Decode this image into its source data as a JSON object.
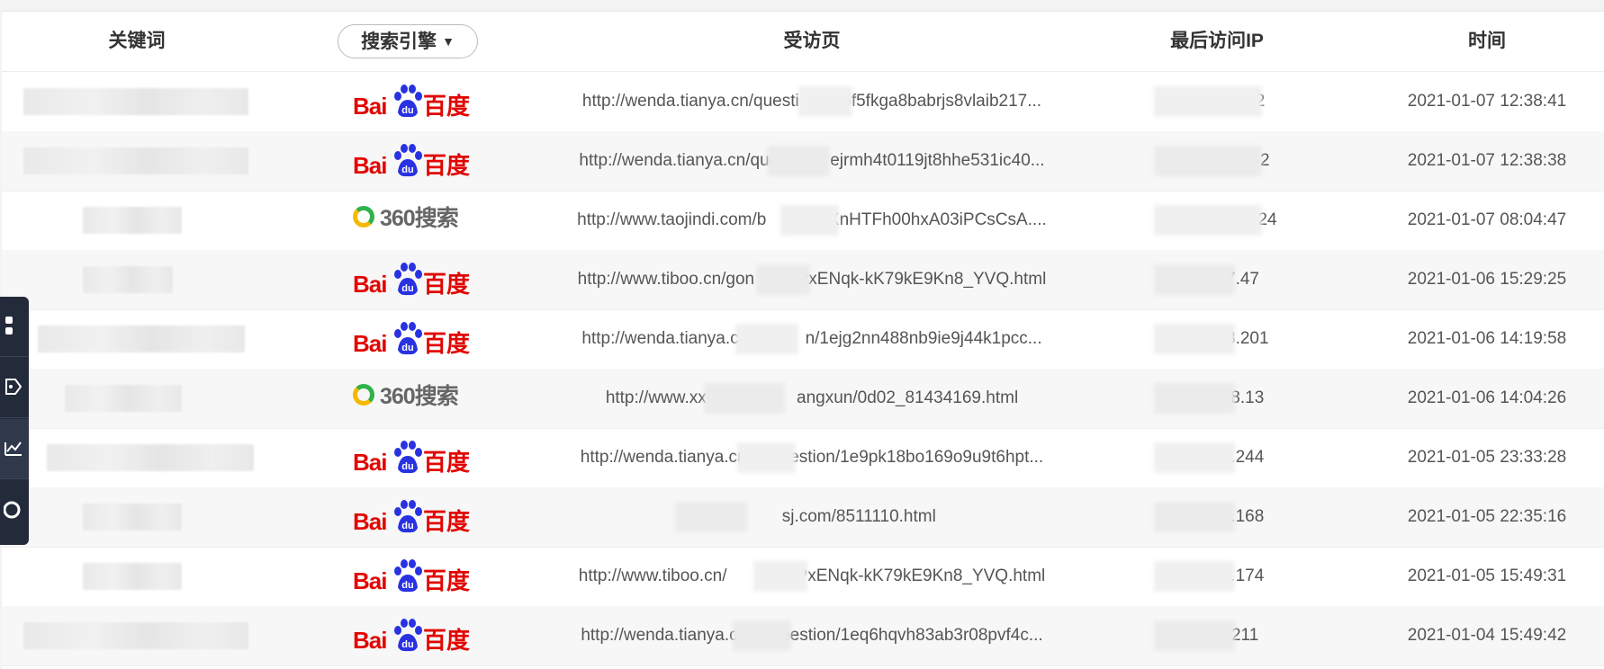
{
  "table": {
    "headers": {
      "keyword": "关键词",
      "search_engine": "搜索引擎",
      "visited_page": "受访页",
      "last_ip": "最后访问IP",
      "time": "时间"
    },
    "search_engine_caret": "▼",
    "rows": [
      {
        "keyword": "",
        "engine": "baidu",
        "url": "http://wenda.tianya.cn/questi█████5f5fkga8babrjs8vlaib217...",
        "ip": "1█████████2",
        "time": "2021-01-07 12:38:41"
      },
      {
        "keyword": "",
        "engine": "baidu",
        "url": "http://wenda.tianya.cn/ques█████ejrmh4t0119jt8hhe531ic40...",
        "ip": "1█████████42",
        "time": "2021-01-07 12:38:38"
      },
      {
        "keyword": "",
        "engine": "360",
        "url": "http://www.taojindi.com/b█████/-xXnHTFh00hxA03iPCsCsA....",
        "ip": "1█████████.124",
        "time": "2021-01-07 08:04:47"
      },
      {
        "keyword": "",
        "engine": "baidu",
        "url": "http://www.tiboo.cn/gon█████PxENqk-kK79kE9Kn8_YVQ.html",
        "ip": "██████7.47",
        "time": "2021-01-06 15:29:25"
      },
      {
        "keyword": "",
        "engine": "baidu",
        "url": "http://wenda.tianya.cn/q█████n/1ejg2nn488nb9ie9j44k1pcc...",
        "ip": "██████38.201",
        "time": "2021-01-06 14:19:58"
      },
      {
        "keyword": "",
        "engine": "360",
        "url": "http://www.xxcmw.c█████angxun/0d02_81434169.html",
        "ip": "██████78.13",
        "time": "2021-01-06 14:04:26"
      },
      {
        "keyword": "",
        "engine": "baidu",
        "url": "http://wenda.tianya.cn█████estion/1e9pk18bo169o9u9t6hpt...",
        "ip": "██████4.244",
        "time": "2021-01-05 23:33:28"
      },
      {
        "keyword": "",
        "engine": "baidu",
        "url": "https://█████sj.com/8511110.html",
        "ip": "██████9.168",
        "time": "2021-01-05 22:35:16"
      },
      {
        "keyword": "",
        "engine": "baidu",
        "url": "http://www.tiboo.cn/█████e/HPxENqk-kK79kE9Kn8_YVQ.html",
        "ip": "██████8.174",
        "time": "2021-01-05 15:49:31"
      },
      {
        "keyword": "",
        "engine": "baidu",
        "url": "http://wenda.tianya.c█████uestion/1eq6hqvh83ab3r08pvf4c...",
        "ip": "██████.211",
        "time": "2021-01-04 15:49:42"
      }
    ]
  },
  "logos": {
    "baidu_left": "Bai",
    "baidu_paw": "du",
    "baidu_right": "百度",
    "so360": "360搜索"
  },
  "colors": {
    "baidu_red": "#e10602",
    "baidu_blue": "#2932e1",
    "so360_green": "#2fb34a",
    "so360_yellow": "#f5b800",
    "sidebar_bg": "#232a3a"
  },
  "sidebar": {
    "items": [
      "grid-icon",
      "tag-icon",
      "trend-chart-icon",
      "circle-record-icon"
    ]
  }
}
